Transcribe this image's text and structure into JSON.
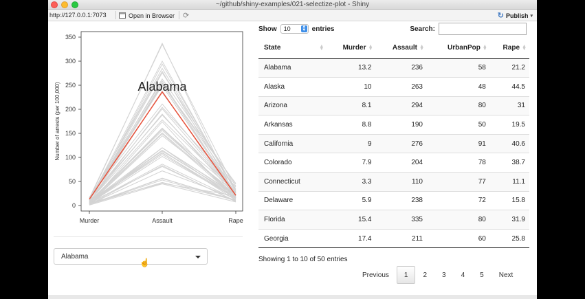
{
  "window": {
    "title": "~/github/shiny-examples/021-selectize-plot - Shiny"
  },
  "toolbar": {
    "url": "http://127.0.0.1:7073",
    "open_in_browser": "Open in Browser",
    "publish": "Publish"
  },
  "chart_data": {
    "type": "line",
    "categories": [
      "Murder",
      "Assault",
      "Rape"
    ],
    "ylabel": "Number of arrests (per 100,000)",
    "ylim": [
      0,
      350
    ],
    "yticks": [
      0,
      50,
      100,
      150,
      200,
      250,
      300,
      350
    ],
    "highlight": {
      "name": "Alabama",
      "values": [
        13.2,
        236,
        21.2
      ],
      "color": "#e8513a"
    },
    "background_color": "#d3d3d3",
    "series": [
      {
        "values": [
          13.2,
          236,
          21.2
        ]
      },
      {
        "values": [
          10,
          263,
          44.5
        ]
      },
      {
        "values": [
          8.1,
          294,
          31
        ]
      },
      {
        "values": [
          8.8,
          190,
          19.5
        ]
      },
      {
        "values": [
          9,
          276,
          40.6
        ]
      },
      {
        "values": [
          7.9,
          204,
          38.7
        ]
      },
      {
        "values": [
          3.3,
          110,
          11.1
        ]
      },
      {
        "values": [
          5.9,
          238,
          15.8
        ]
      },
      {
        "values": [
          15.4,
          335,
          31.9
        ]
      },
      {
        "values": [
          17.4,
          211,
          25.8
        ]
      },
      {
        "values": [
          5.3,
          46,
          20.2
        ]
      },
      {
        "values": [
          2.6,
          120,
          14.2
        ]
      },
      {
        "values": [
          10.4,
          249,
          24
        ]
      },
      {
        "values": [
          7.2,
          113,
          21
        ]
      },
      {
        "values": [
          2.2,
          56,
          11.3
        ]
      },
      {
        "values": [
          6,
          115,
          18
        ]
      },
      {
        "values": [
          9.7,
          109,
          16.3
        ]
      },
      {
        "values": [
          15.4,
          249,
          22.2
        ]
      },
      {
        "values": [
          2.1,
          83,
          7.8
        ]
      },
      {
        "values": [
          11.3,
          300,
          27.8
        ]
      },
      {
        "values": [
          4.4,
          149,
          16.3
        ]
      },
      {
        "values": [
          12.1,
          255,
          35.1
        ]
      },
      {
        "values": [
          2.7,
          72,
          14.9
        ]
      },
      {
        "values": [
          16.1,
          259,
          17.1
        ]
      },
      {
        "values": [
          9,
          178,
          28.2
        ]
      },
      {
        "values": [
          6,
          109,
          16.4
        ]
      },
      {
        "values": [
          4.3,
          102,
          16.5
        ]
      },
      {
        "values": [
          12.2,
          252,
          46
        ]
      },
      {
        "values": [
          2.1,
          57,
          9.5
        ]
      },
      {
        "values": [
          7.4,
          159,
          18.8
        ]
      },
      {
        "values": [
          11.4,
          285,
          32.1
        ]
      },
      {
        "values": [
          11.1,
          254,
          26.1
        ]
      },
      {
        "values": [
          13,
          337,
          16.1
        ]
      },
      {
        "values": [
          0.8,
          45,
          7.3
        ]
      },
      {
        "values": [
          7.3,
          120,
          21.4
        ]
      },
      {
        "values": [
          6.6,
          151,
          20
        ]
      },
      {
        "values": [
          4.9,
          159,
          29.3
        ]
      },
      {
        "values": [
          6.3,
          106,
          14.9
        ]
      },
      {
        "values": [
          3.4,
          174,
          8.3
        ]
      },
      {
        "values": [
          14.4,
          279,
          22.5
        ]
      },
      {
        "values": [
          3.8,
          86,
          12.8
        ]
      },
      {
        "values": [
          13.2,
          188,
          26.9
        ]
      },
      {
        "values": [
          12.7,
          201,
          25.5
        ]
      },
      {
        "values": [
          3.2,
          120,
          22.9
        ]
      },
      {
        "values": [
          2.2,
          48,
          11.2
        ]
      },
      {
        "values": [
          8.5,
          156,
          20.7
        ]
      },
      {
        "values": [
          4,
          145,
          26.2
        ]
      },
      {
        "values": [
          5.7,
          81,
          9.3
        ]
      },
      {
        "values": [
          2.6,
          53,
          10.8
        ]
      },
      {
        "values": [
          6.8,
          161,
          15.6
        ]
      }
    ]
  },
  "selector": {
    "value": "Alabama"
  },
  "table": {
    "show_label": "Show",
    "entries_label": "entries",
    "length_value": "10",
    "search_label": "Search:",
    "search_value": "",
    "columns": [
      "State",
      "Murder",
      "Assault",
      "UrbanPop",
      "Rape"
    ],
    "rows": [
      [
        "Alabama",
        "13.2",
        "236",
        "58",
        "21.2"
      ],
      [
        "Alaska",
        "10",
        "263",
        "48",
        "44.5"
      ],
      [
        "Arizona",
        "8.1",
        "294",
        "80",
        "31"
      ],
      [
        "Arkansas",
        "8.8",
        "190",
        "50",
        "19.5"
      ],
      [
        "California",
        "9",
        "276",
        "91",
        "40.6"
      ],
      [
        "Colorado",
        "7.9",
        "204",
        "78",
        "38.7"
      ],
      [
        "Connecticut",
        "3.3",
        "110",
        "77",
        "11.1"
      ],
      [
        "Delaware",
        "5.9",
        "238",
        "72",
        "15.8"
      ],
      [
        "Florida",
        "15.4",
        "335",
        "80",
        "31.9"
      ],
      [
        "Georgia",
        "17.4",
        "211",
        "60",
        "25.8"
      ]
    ],
    "info": "Showing 1 to 10 of 50 entries",
    "pager": {
      "previous": "Previous",
      "pages": [
        "1",
        "2",
        "3",
        "4",
        "5"
      ],
      "next": "Next",
      "current": "1"
    }
  }
}
